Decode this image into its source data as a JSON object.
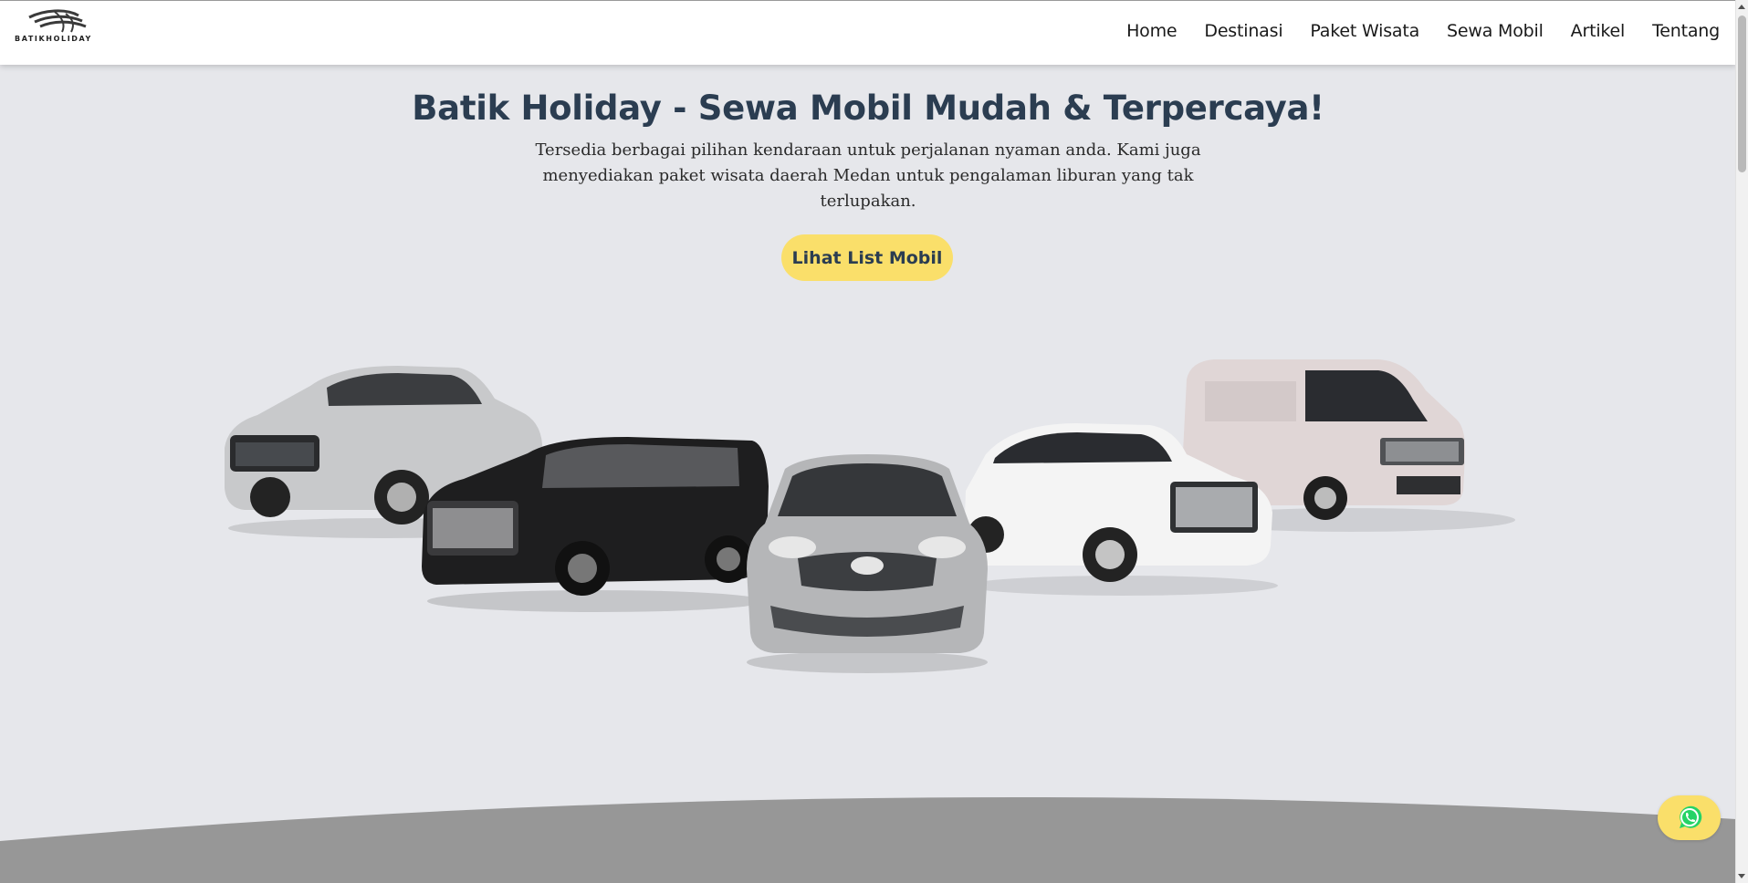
{
  "brand": {
    "name": "BATIKHOLIDAY",
    "logo_icon": "wing-stripes-logo"
  },
  "nav": {
    "items": [
      {
        "label": "Home"
      },
      {
        "label": "Destinasi"
      },
      {
        "label": "Paket Wisata"
      },
      {
        "label": "Sewa Mobil"
      },
      {
        "label": "Artikel"
      },
      {
        "label": "Tentang"
      }
    ]
  },
  "hero": {
    "title": "Batik Holiday - Sewa Mobil Mudah & Terpercaya!",
    "subtitle": "Tersedia berbagai pilihan kendaraan untuk perjalanan nyaman anda. Kami juga menyediakan paket wisata daerah Medan untuk pengalaman liburan yang tak terlupakan.",
    "cta_label": "Lihat List Mobil"
  },
  "cars": [
    {
      "name": "silver-suv",
      "color": "#c8c9cb"
    },
    {
      "name": "black-mpv",
      "color": "#1e1e1f"
    },
    {
      "name": "silver-sedan",
      "color": "#b5b6b8"
    },
    {
      "name": "white-suv",
      "color": "#f4f4f4"
    },
    {
      "name": "white-van",
      "color": "#e0d6d6"
    }
  ],
  "floating": {
    "icon": "whatsapp-icon",
    "accent": "#fadf6a",
    "icon_color": "#25d366"
  },
  "colors": {
    "background": "#e6e7eb",
    "title": "#2b3d51",
    "button": "#fadf6a",
    "wave": "#979797"
  }
}
